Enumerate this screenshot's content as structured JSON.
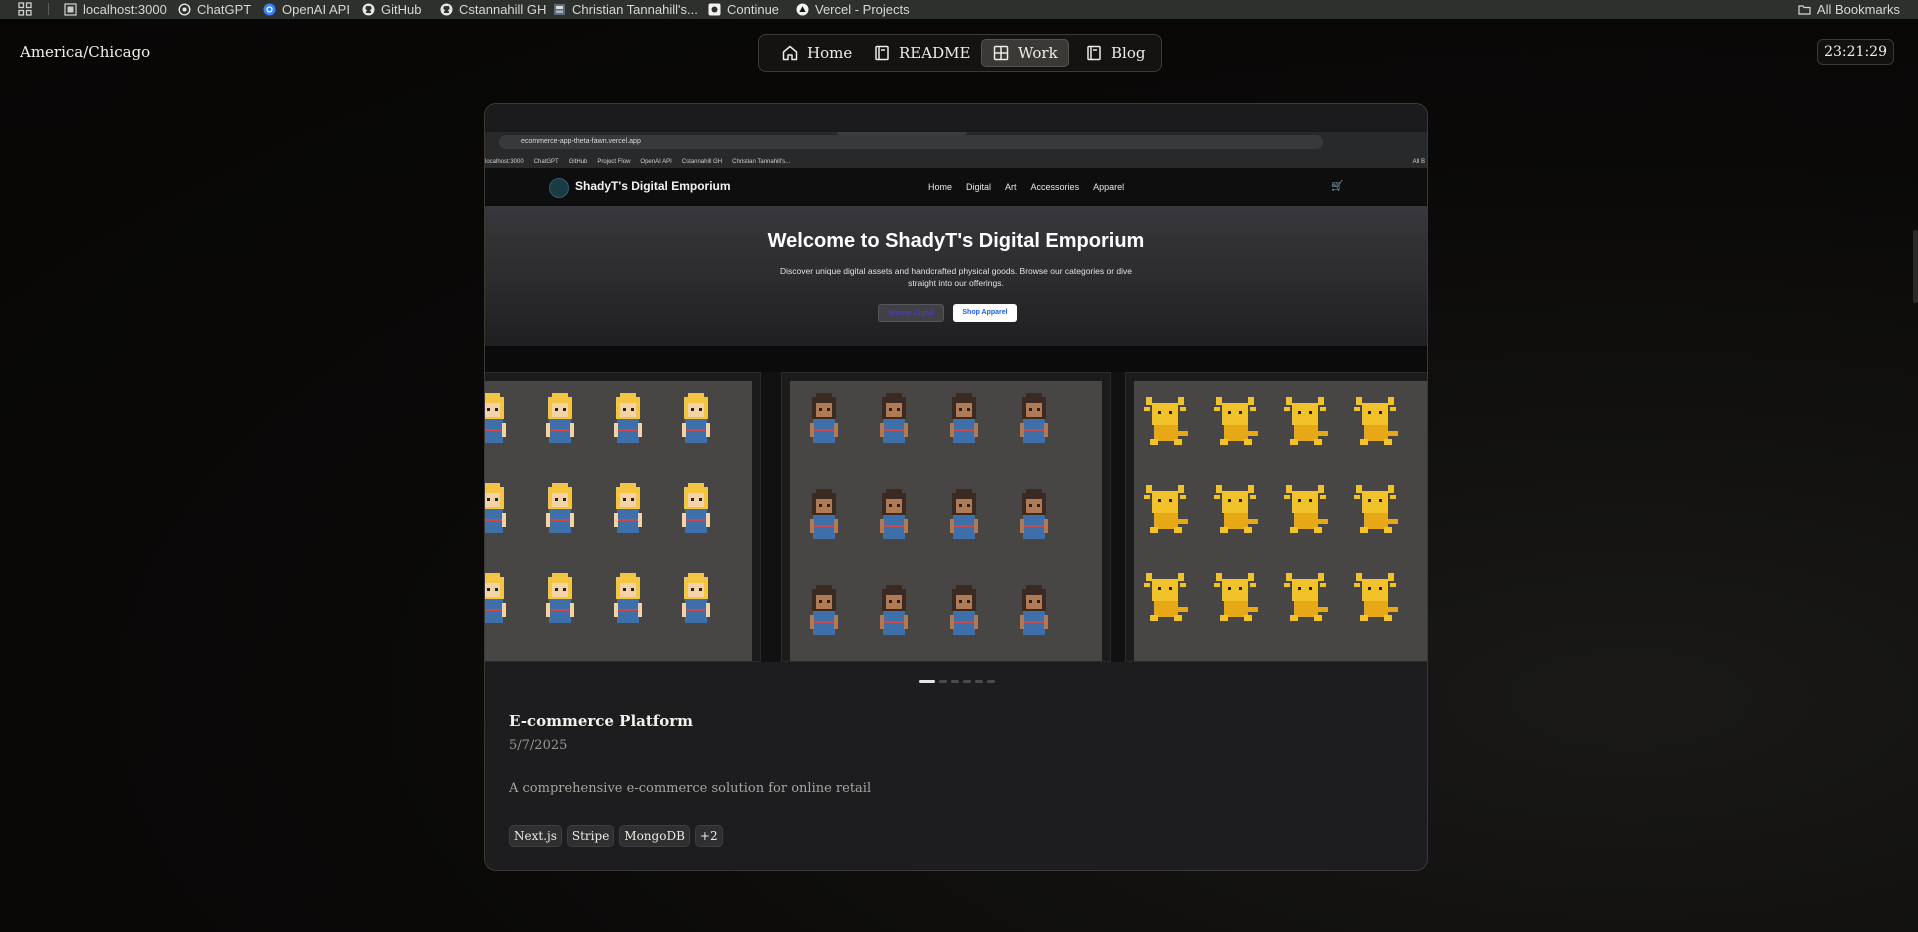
{
  "bookmarks": {
    "items": [
      {
        "label": "localhost:3000",
        "icon": "localhost-icon"
      },
      {
        "label": "ChatGPT",
        "icon": "chatgpt-icon"
      },
      {
        "label": "OpenAI API",
        "icon": "openai-icon"
      },
      {
        "label": "GitHub",
        "icon": "github-icon"
      },
      {
        "label": "Cstannahill GH",
        "icon": "github-icon"
      },
      {
        "label": "Christian Tannahill's...",
        "icon": "page-icon"
      },
      {
        "label": "Continue",
        "icon": "continue-icon"
      },
      {
        "label": "Vercel - Projects",
        "icon": "vercel-icon"
      }
    ],
    "all_bookmarks": "All Bookmarks"
  },
  "header": {
    "timezone": "America/Chicago",
    "clock": "23:21:29",
    "nav": [
      {
        "label": "Home",
        "icon": "home-icon",
        "active": false
      },
      {
        "label": "README",
        "icon": "book-icon",
        "active": false
      },
      {
        "label": "Work",
        "icon": "grid-icon",
        "active": true
      },
      {
        "label": "Blog",
        "icon": "book-icon",
        "active": false
      }
    ]
  },
  "screenshot": {
    "url": "ecommerce-app-theta-fawn.vercel.app",
    "bookmarks": [
      "localhost:3000",
      "ChatGPT",
      "GitHub",
      "Project Flow",
      "OpenAI API",
      "Cstannahill GH",
      "Christian Tannahill's...",
      "All B"
    ],
    "brand": "ShadyT's Digital Emporium",
    "links": [
      "Home",
      "Digital",
      "Art",
      "Accessories",
      "Apparel"
    ],
    "hero_title": "Welcome to ShadyT's Digital Emporium",
    "hero_text": "Discover unique digital assets and handcrafted physical goods. Browse our categories or dive straight into our offerings.",
    "btn_primary": "Browse Digital",
    "btn_secondary": "Shop Apparel"
  },
  "carousel": {
    "slide_count": 6,
    "active_slide": 1
  },
  "project": {
    "title": "E-commerce Platform",
    "date": "5/7/2025",
    "description": "A comprehensive e-commerce solution for online retail",
    "tags": [
      "Next.js",
      "Stripe",
      "MongoDB",
      "+2"
    ]
  },
  "colors": {
    "accent_cart": "#2fb34b",
    "sprite_blue": "#3f6fa8",
    "sprite_gold": "#f2c22a"
  }
}
